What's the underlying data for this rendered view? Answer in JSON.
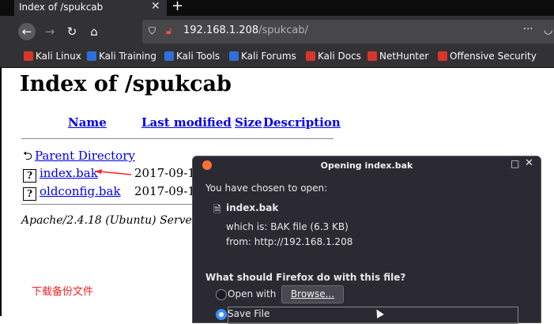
{
  "tab": {
    "title": "Index of /spukcab",
    "close": "✕",
    "new_tab": "+"
  },
  "toolbar": {
    "back": "←",
    "forward": "→",
    "reload": "↻",
    "home": "⌂"
  },
  "urlbar": {
    "host": "192.168.1.208",
    "path": "/spukcab/",
    "more": "···"
  },
  "bookmarks": [
    {
      "label": "Kali Linux",
      "color": "#d9362b"
    },
    {
      "label": "Kali Training",
      "color": "#2f6fdb"
    },
    {
      "label": "Kali Tools",
      "color": "#2f6fdb"
    },
    {
      "label": "Kali Forums",
      "color": "#2f6fdb"
    },
    {
      "label": "Kali Docs",
      "color": "#d9362b"
    },
    {
      "label": "NetHunter",
      "color": "#d9362b"
    },
    {
      "label": "Offensive Security",
      "color": "#d9362b"
    }
  ],
  "page": {
    "title": "Index of /spukcab",
    "headers": {
      "name": "Name",
      "last_modified": "Last modified",
      "size": "Size",
      "description": "Description"
    },
    "rows": [
      {
        "name": "Parent Directory",
        "date": ""
      },
      {
        "name": "index.bak",
        "date": "2017-09-11"
      },
      {
        "name": "oldconfig.bak",
        "date": "2017-09-11"
      }
    ],
    "server": "Apache/2.4.18 (Ubuntu) Server",
    "annotation": "下载备份文件"
  },
  "dialog": {
    "title": "Opening index.bak",
    "chosen": "You have chosen to open:",
    "filename": "index.bak",
    "which_is": "which is:  BAK file (6.3 KB)",
    "from": "from:  http://192.168.1.208",
    "question": "What should Firefox do with this file?",
    "open_with": "Open with",
    "browse": "Browse...",
    "save_file": "Save File"
  }
}
